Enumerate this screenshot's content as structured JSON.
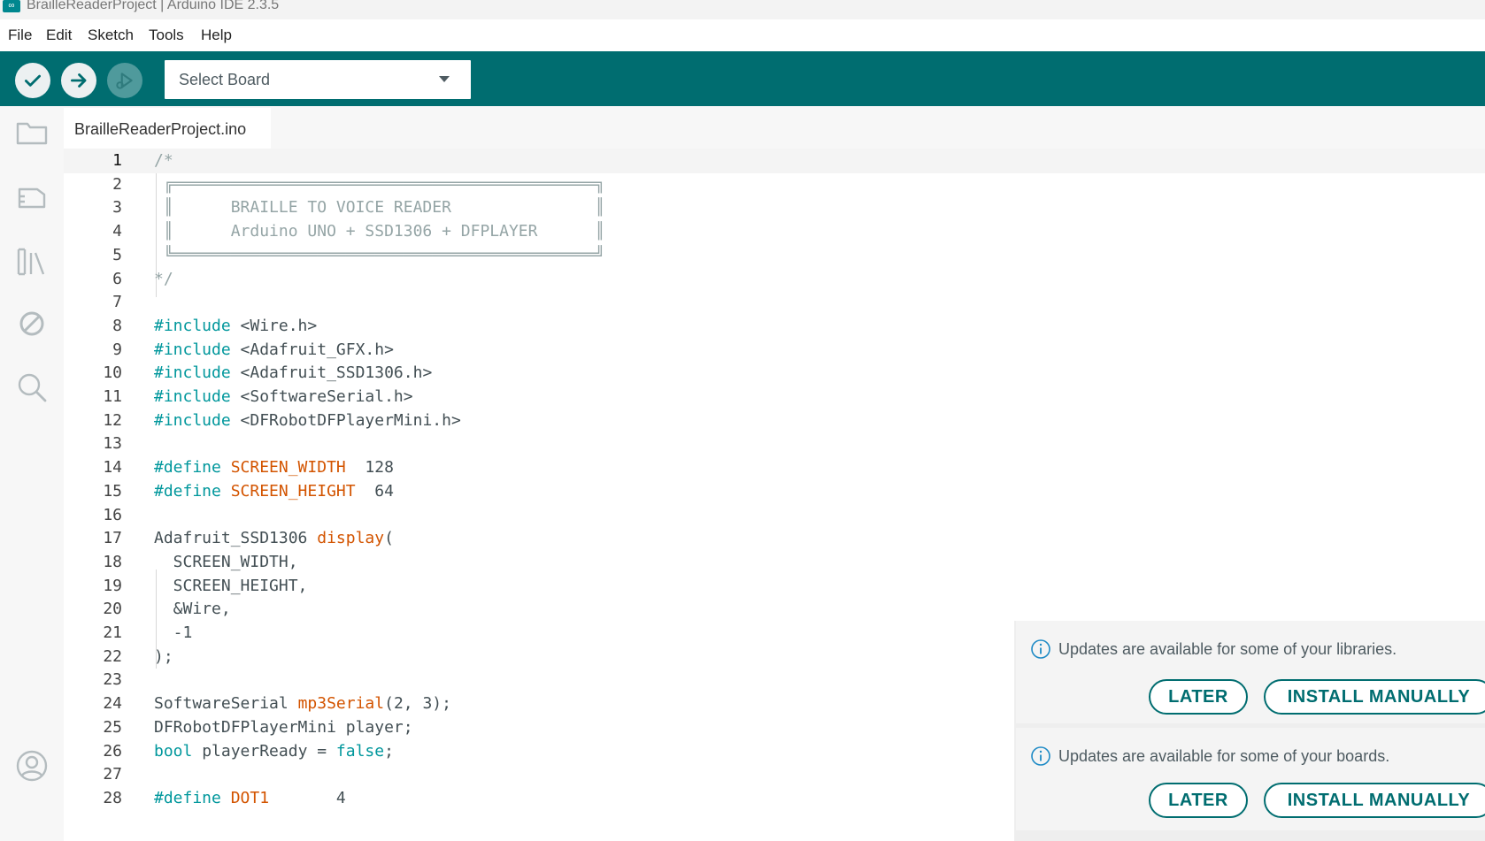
{
  "window": {
    "title": "BrailleReaderProject | Arduino IDE 2.3.5",
    "app_icon": "infinity-logo-icon",
    "app_icon_glyph": "∞"
  },
  "menu": [
    "File",
    "Edit",
    "Sketch",
    "Tools",
    "Help"
  ],
  "toolbar": {
    "verify": "check-icon",
    "upload": "arrow-right-icon",
    "debug": "debug-play-icon",
    "board_select": "Select Board",
    "colors": {
      "toolbar_bg": "#006d70",
      "button_bg": "#ecf0f1"
    }
  },
  "sidebar": [
    "folder-icon",
    "board-manager-icon",
    "library-icon",
    "debug-disabled-icon",
    "search-icon",
    "account-icon"
  ],
  "tabs": [
    {
      "label": "BrailleReaderProject.ino",
      "active": true
    }
  ],
  "editor": {
    "current_line": 1,
    "line_numbers": [
      "1",
      "2",
      "3",
      "4",
      "5",
      "6",
      "7",
      "8",
      "9",
      "10",
      "11",
      "12",
      "13",
      "14",
      "15",
      "16",
      "17",
      "18",
      "19",
      "20",
      "21",
      "22",
      "23",
      "24",
      "25",
      "26",
      "27",
      "28"
    ],
    "lines": [
      [
        {
          "t": "/*",
          "c": "cm"
        }
      ],
      [
        {
          "t": " ╔════════════════════════════════════════════╗",
          "c": "cm"
        }
      ],
      [
        {
          "t": " ║      BRAILLE TO VOICE READER               ║",
          "c": "cm"
        }
      ],
      [
        {
          "t": " ║      Arduino UNO + SSD1306 + DFPLAYER      ║",
          "c": "cm"
        }
      ],
      [
        {
          "t": " ╚════════════════════════════════════════════╝",
          "c": "cm"
        }
      ],
      [
        {
          "t": "*/",
          "c": "cm"
        }
      ],
      [],
      [
        {
          "t": "#include",
          "c": "kw"
        },
        {
          "t": " <Wire.h>",
          "c": ""
        }
      ],
      [
        {
          "t": "#include",
          "c": "kw"
        },
        {
          "t": " <Adafruit_GFX.h>",
          "c": ""
        }
      ],
      [
        {
          "t": "#include",
          "c": "kw"
        },
        {
          "t": " <Adafruit_SSD1306.h>",
          "c": ""
        }
      ],
      [
        {
          "t": "#include",
          "c": "kw"
        },
        {
          "t": " <SoftwareSerial.h>",
          "c": ""
        }
      ],
      [
        {
          "t": "#include",
          "c": "kw"
        },
        {
          "t": " <DFRobotDFPlayerMini.h>",
          "c": ""
        }
      ],
      [],
      [
        {
          "t": "#define",
          "c": "kw"
        },
        {
          "t": " ",
          "c": ""
        },
        {
          "t": "SCREEN_WIDTH",
          "c": "fn"
        },
        {
          "t": "  128",
          "c": ""
        }
      ],
      [
        {
          "t": "#define",
          "c": "kw"
        },
        {
          "t": " ",
          "c": ""
        },
        {
          "t": "SCREEN_HEIGHT",
          "c": "fn"
        },
        {
          "t": "  64",
          "c": ""
        }
      ],
      [],
      [
        {
          "t": "Adafruit_SSD1306 ",
          "c": ""
        },
        {
          "t": "display",
          "c": "fn"
        },
        {
          "t": "(",
          "c": ""
        }
      ],
      [
        {
          "t": "  SCREEN_WIDTH,",
          "c": ""
        }
      ],
      [
        {
          "t": "  SCREEN_HEIGHT,",
          "c": ""
        }
      ],
      [
        {
          "t": "  &Wire,",
          "c": ""
        }
      ],
      [
        {
          "t": "  -1",
          "c": ""
        }
      ],
      [
        {
          "t": ");",
          "c": ""
        }
      ],
      [],
      [
        {
          "t": "SoftwareSerial ",
          "c": ""
        },
        {
          "t": "mp3Serial",
          "c": "fn"
        },
        {
          "t": "(2, 3);",
          "c": ""
        }
      ],
      [
        {
          "t": "DFRobotDFPlayerMini player;",
          "c": ""
        }
      ],
      [
        {
          "t": "bool",
          "c": "kw"
        },
        {
          "t": " playerReady = ",
          "c": ""
        },
        {
          "t": "false",
          "c": "kw"
        },
        {
          "t": ";",
          "c": ""
        }
      ],
      [],
      [
        {
          "t": "#define",
          "c": "kw"
        },
        {
          "t": " ",
          "c": ""
        },
        {
          "t": "DOT1",
          "c": "fn"
        },
        {
          "t": "       4",
          "c": ""
        }
      ]
    ]
  },
  "notifications": [
    {
      "icon": "info-icon",
      "text": "Updates are available for some of your libraries.",
      "later": "LATER",
      "install": "INSTALL MANUALLY"
    },
    {
      "icon": "info-icon",
      "text": "Updates are available for some of your boards.",
      "later": "LATER",
      "install": "INSTALL MANUALLY"
    }
  ]
}
